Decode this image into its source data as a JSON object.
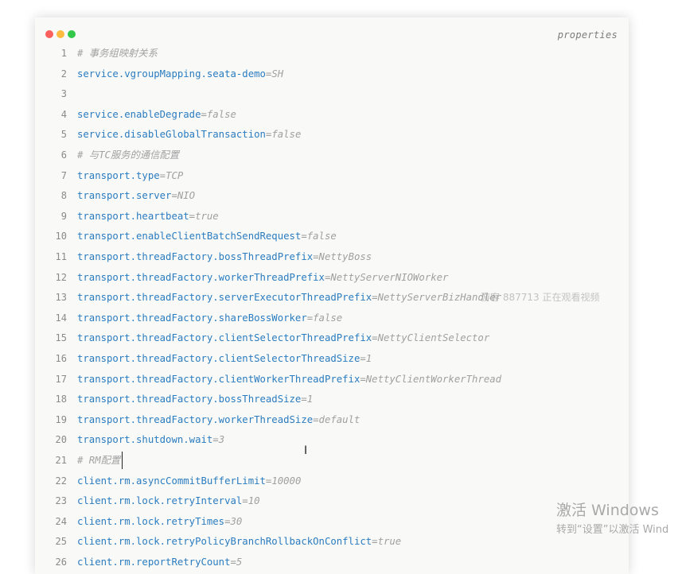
{
  "editor": {
    "language": "properties",
    "window_controls": [
      {
        "name": "close",
        "color": "#fc605c"
      },
      {
        "name": "minimize",
        "color": "#fdbc40"
      },
      {
        "name": "maximize",
        "color": "#34c84a"
      }
    ],
    "lines": [
      {
        "n": "1",
        "comment": "# 事务组映射关系"
      },
      {
        "n": "2",
        "key": "service.vgroupMapping.seata-demo",
        "value": "SH"
      },
      {
        "n": "3"
      },
      {
        "n": "4",
        "key": "service.enableDegrade",
        "value": "false"
      },
      {
        "n": "5",
        "key": "service.disableGlobalTransaction",
        "value": "false"
      },
      {
        "n": "6",
        "comment": "# 与TC服务的通信配置"
      },
      {
        "n": "7",
        "key": "transport.type",
        "value": "TCP"
      },
      {
        "n": "8",
        "key": "transport.server",
        "value": "NIO"
      },
      {
        "n": "9",
        "key": "transport.heartbeat",
        "value": "true"
      },
      {
        "n": "10",
        "key": "transport.enableClientBatchSendRequest",
        "value": "false"
      },
      {
        "n": "11",
        "key": "transport.threadFactory.bossThreadPrefix",
        "value": "NettyBoss"
      },
      {
        "n": "12",
        "key": "transport.threadFactory.workerThreadPrefix",
        "value": "NettyServerNIOWorker"
      },
      {
        "n": "13",
        "key": "transport.threadFactory.serverExecutorThreadPrefix",
        "value": "NettyServerBizHandler"
      },
      {
        "n": "14",
        "key": "transport.threadFactory.shareBossWorker",
        "value": "false"
      },
      {
        "n": "15",
        "key": "transport.threadFactory.clientSelectorThreadPrefix",
        "value": "NettyClientSelector"
      },
      {
        "n": "16",
        "key": "transport.threadFactory.clientSelectorThreadSize",
        "value": "1"
      },
      {
        "n": "17",
        "key": "transport.threadFactory.clientWorkerThreadPrefix",
        "value": "NettyClientWorkerThread"
      },
      {
        "n": "18",
        "key": "transport.threadFactory.bossThreadSize",
        "value": "1"
      },
      {
        "n": "19",
        "key": "transport.threadFactory.workerThreadSize",
        "value": "default"
      },
      {
        "n": "20",
        "key": "transport.shutdown.wait",
        "value": "3"
      },
      {
        "n": "21",
        "comment": "# RM配置"
      },
      {
        "n": "22",
        "key": "client.rm.asyncCommitBufferLimit",
        "value": "10000"
      },
      {
        "n": "23",
        "key": "client.rm.lock.retryInterval",
        "value": "10"
      },
      {
        "n": "24",
        "key": "client.rm.lock.retryTimes",
        "value": "30"
      },
      {
        "n": "25",
        "key": "client.rm.lock.retryPolicyBranchRollbackOnConflict",
        "value": "true"
      },
      {
        "n": "26",
        "key": "client.rm.reportRetryCount",
        "value": "5"
      }
    ]
  },
  "overlay": {
    "viewer_watermark": "游客 887713 正在观看视频",
    "activation_title": "激活 Windows",
    "activation_hint": "转到“设置”以激活 Wind"
  }
}
